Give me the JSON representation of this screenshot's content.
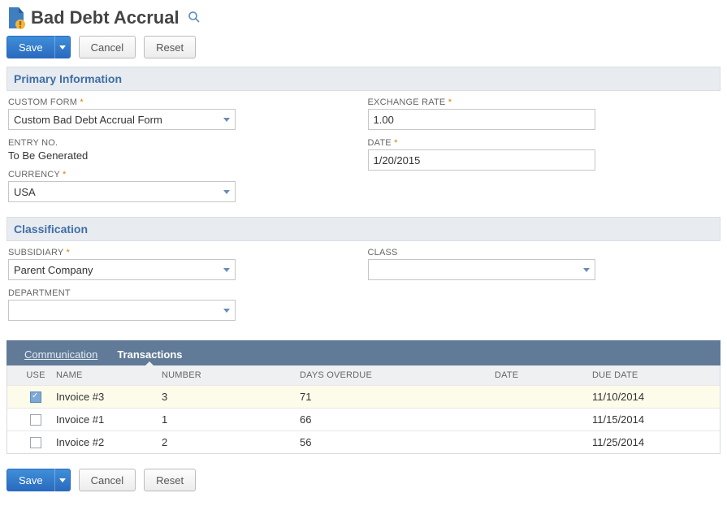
{
  "page": {
    "title": "Bad Debt Accrual"
  },
  "actions": {
    "save": "Save",
    "cancel": "Cancel",
    "reset": "Reset"
  },
  "sections": {
    "primary_information": "Primary Information",
    "classification": "Classification"
  },
  "fields": {
    "custom_form": {
      "label": "CUSTOM FORM",
      "value": "Custom Bad Debt Accrual Form",
      "required": true
    },
    "entry_no": {
      "label": "ENTRY NO.",
      "value": "To Be Generated"
    },
    "currency": {
      "label": "CURRENCY",
      "value": "USA",
      "required": true
    },
    "exchange_rate": {
      "label": "EXCHANGE RATE",
      "value": "1.00",
      "required": true
    },
    "date": {
      "label": "DATE",
      "value": "1/20/2015",
      "required": true
    },
    "subsidiary": {
      "label": "SUBSIDIARY",
      "value": "Parent Company",
      "required": true
    },
    "department": {
      "label": "DEPARTMENT",
      "value": ""
    },
    "class": {
      "label": "CLASS",
      "value": ""
    }
  },
  "tabs": {
    "communication": "Communication",
    "transactions": "Transactions",
    "active": "transactions"
  },
  "grid": {
    "headers": {
      "use": "USE",
      "name": "NAME",
      "number": "NUMBER",
      "days_overdue": "DAYS OVERDUE",
      "date": "DATE",
      "due_date": "DUE DATE"
    },
    "rows": [
      {
        "use": true,
        "name": "Invoice #3",
        "number": "3",
        "days_overdue": "71",
        "date": "",
        "due_date": "11/10/2014"
      },
      {
        "use": false,
        "name": "Invoice #1",
        "number": "1",
        "days_overdue": "66",
        "date": "",
        "due_date": "11/15/2014"
      },
      {
        "use": false,
        "name": "Invoice #2",
        "number": "2",
        "days_overdue": "56",
        "date": "",
        "due_date": "11/25/2014"
      }
    ]
  }
}
